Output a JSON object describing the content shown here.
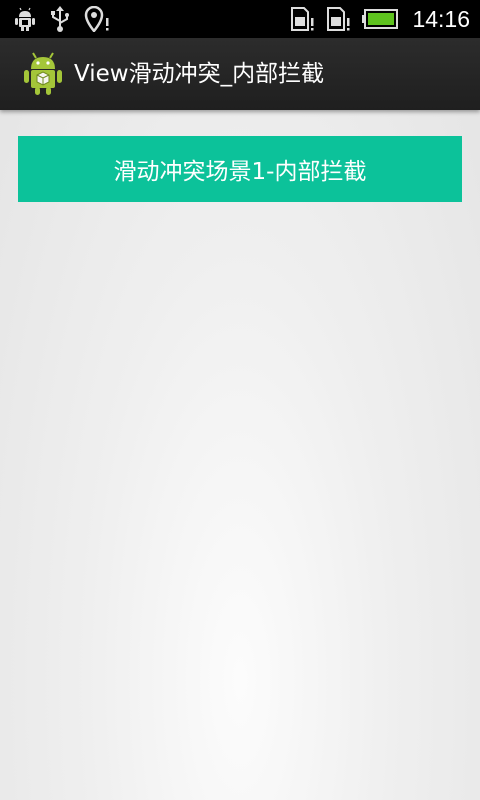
{
  "status_bar": {
    "time": "14:16",
    "icons": [
      "debug-icon",
      "usb-icon",
      "location-alert-icon",
      "sim-card-alert-icon",
      "sim-card-alert-icon",
      "battery-icon"
    ]
  },
  "action_bar": {
    "title": "View滑动冲突_内部拦截",
    "icon": "android-icon"
  },
  "main": {
    "scenario_button_label": "滑动冲突场景1-内部拦截"
  },
  "colors": {
    "accent": "#0cc29a",
    "action_bar": "#262626",
    "status_bar": "#000000"
  }
}
